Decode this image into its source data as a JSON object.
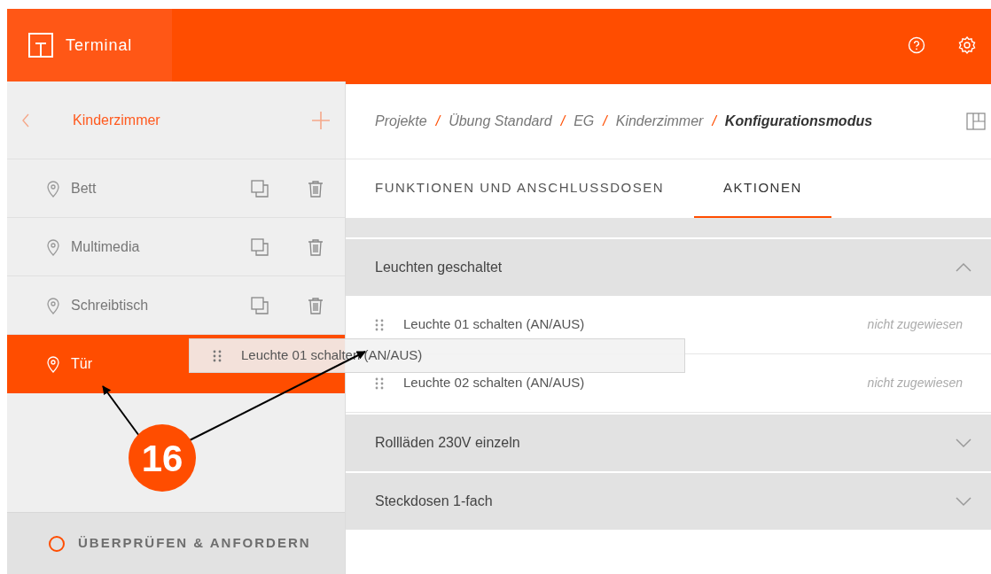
{
  "header": {
    "title": "Terminal"
  },
  "sidebar": {
    "room": "Kinderzimmer",
    "items": [
      {
        "label": "Bett",
        "selected": false
      },
      {
        "label": "Multimedia",
        "selected": false
      },
      {
        "label": "Schreibtisch",
        "selected": false
      },
      {
        "label": "Tür",
        "selected": true
      }
    ],
    "review_button": "ÜBERPRÜFEN & ANFORDERN"
  },
  "breadcrumb": [
    {
      "label": "Projekte",
      "current": false
    },
    {
      "separator": "/",
      "label": "Übung Standard",
      "current": false
    },
    {
      "separator": "/",
      "label": "EG",
      "current": false
    },
    {
      "separator": "/",
      "label": "Kinderzimmer",
      "current": false
    },
    {
      "separator": "/",
      "label": "Konfigurationsmodus",
      "current": true
    }
  ],
  "tabs": [
    {
      "label": "FUNKTIONEN UND ANSCHLUSSDOSEN",
      "selected": false
    },
    {
      "label": "AKTIONEN",
      "selected": true
    }
  ],
  "groups": [
    {
      "title": "Leuchten geschaltet",
      "expanded": true,
      "items": [
        {
          "label": "Leuchte 01 schalten (AN/AUS)",
          "status": "nicht zugewiesen"
        },
        {
          "label": "Leuchte 02 schalten (AN/AUS)",
          "status": "nicht zugewiesen"
        }
      ]
    },
    {
      "title": "Rollläden 230V einzeln",
      "expanded": false
    },
    {
      "title": "Steckdosen 1-fach",
      "expanded": false
    }
  ],
  "drag_item": {
    "label": "Leuchte 01 schalten (AN/AUS)"
  },
  "callout": {
    "number": "16"
  }
}
